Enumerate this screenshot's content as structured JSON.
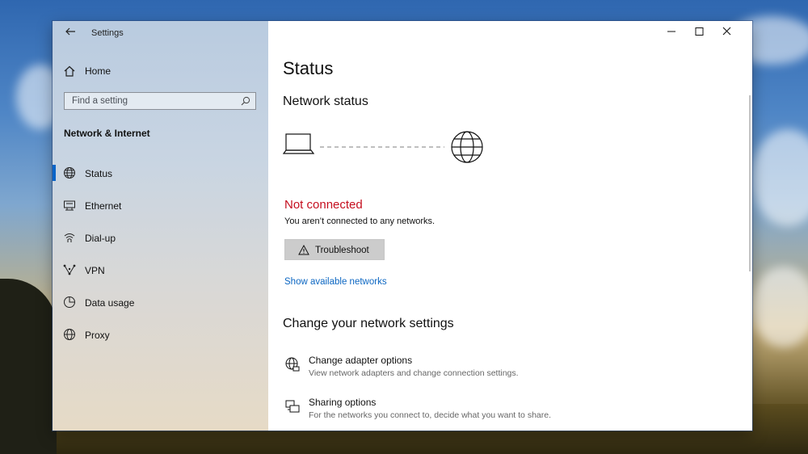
{
  "window": {
    "title": "Settings"
  },
  "sidebar": {
    "home_label": "Home",
    "search_placeholder": "Find a setting",
    "section_heading": "Network & Internet",
    "items": [
      {
        "label": "Status",
        "icon": "globe-icon",
        "selected": true
      },
      {
        "label": "Ethernet",
        "icon": "ethernet-icon",
        "selected": false
      },
      {
        "label": "Dial-up",
        "icon": "dialup-icon",
        "selected": false
      },
      {
        "label": "VPN",
        "icon": "vpn-icon",
        "selected": false
      },
      {
        "label": "Data usage",
        "icon": "data-usage-icon",
        "selected": false
      },
      {
        "label": "Proxy",
        "icon": "globe-icon",
        "selected": false
      }
    ]
  },
  "main": {
    "page_title": "Status",
    "network_status_heading": "Network status",
    "status_title": "Not connected",
    "status_description": "You aren’t connected to any networks.",
    "troubleshoot_label": "Troubleshoot",
    "show_networks_link": "Show available networks",
    "change_heading": "Change your network settings",
    "options": [
      {
        "title": "Change adapter options",
        "description": "View network adapters and change connection settings.",
        "icon": "adapter-icon"
      },
      {
        "title": "Sharing options",
        "description": "For the networks you connect to, decide what you want to share.",
        "icon": "sharing-icon"
      }
    ]
  },
  "colors": {
    "accent": "#0a64c8",
    "error": "#c50f1f",
    "link": "#0b66c2"
  }
}
